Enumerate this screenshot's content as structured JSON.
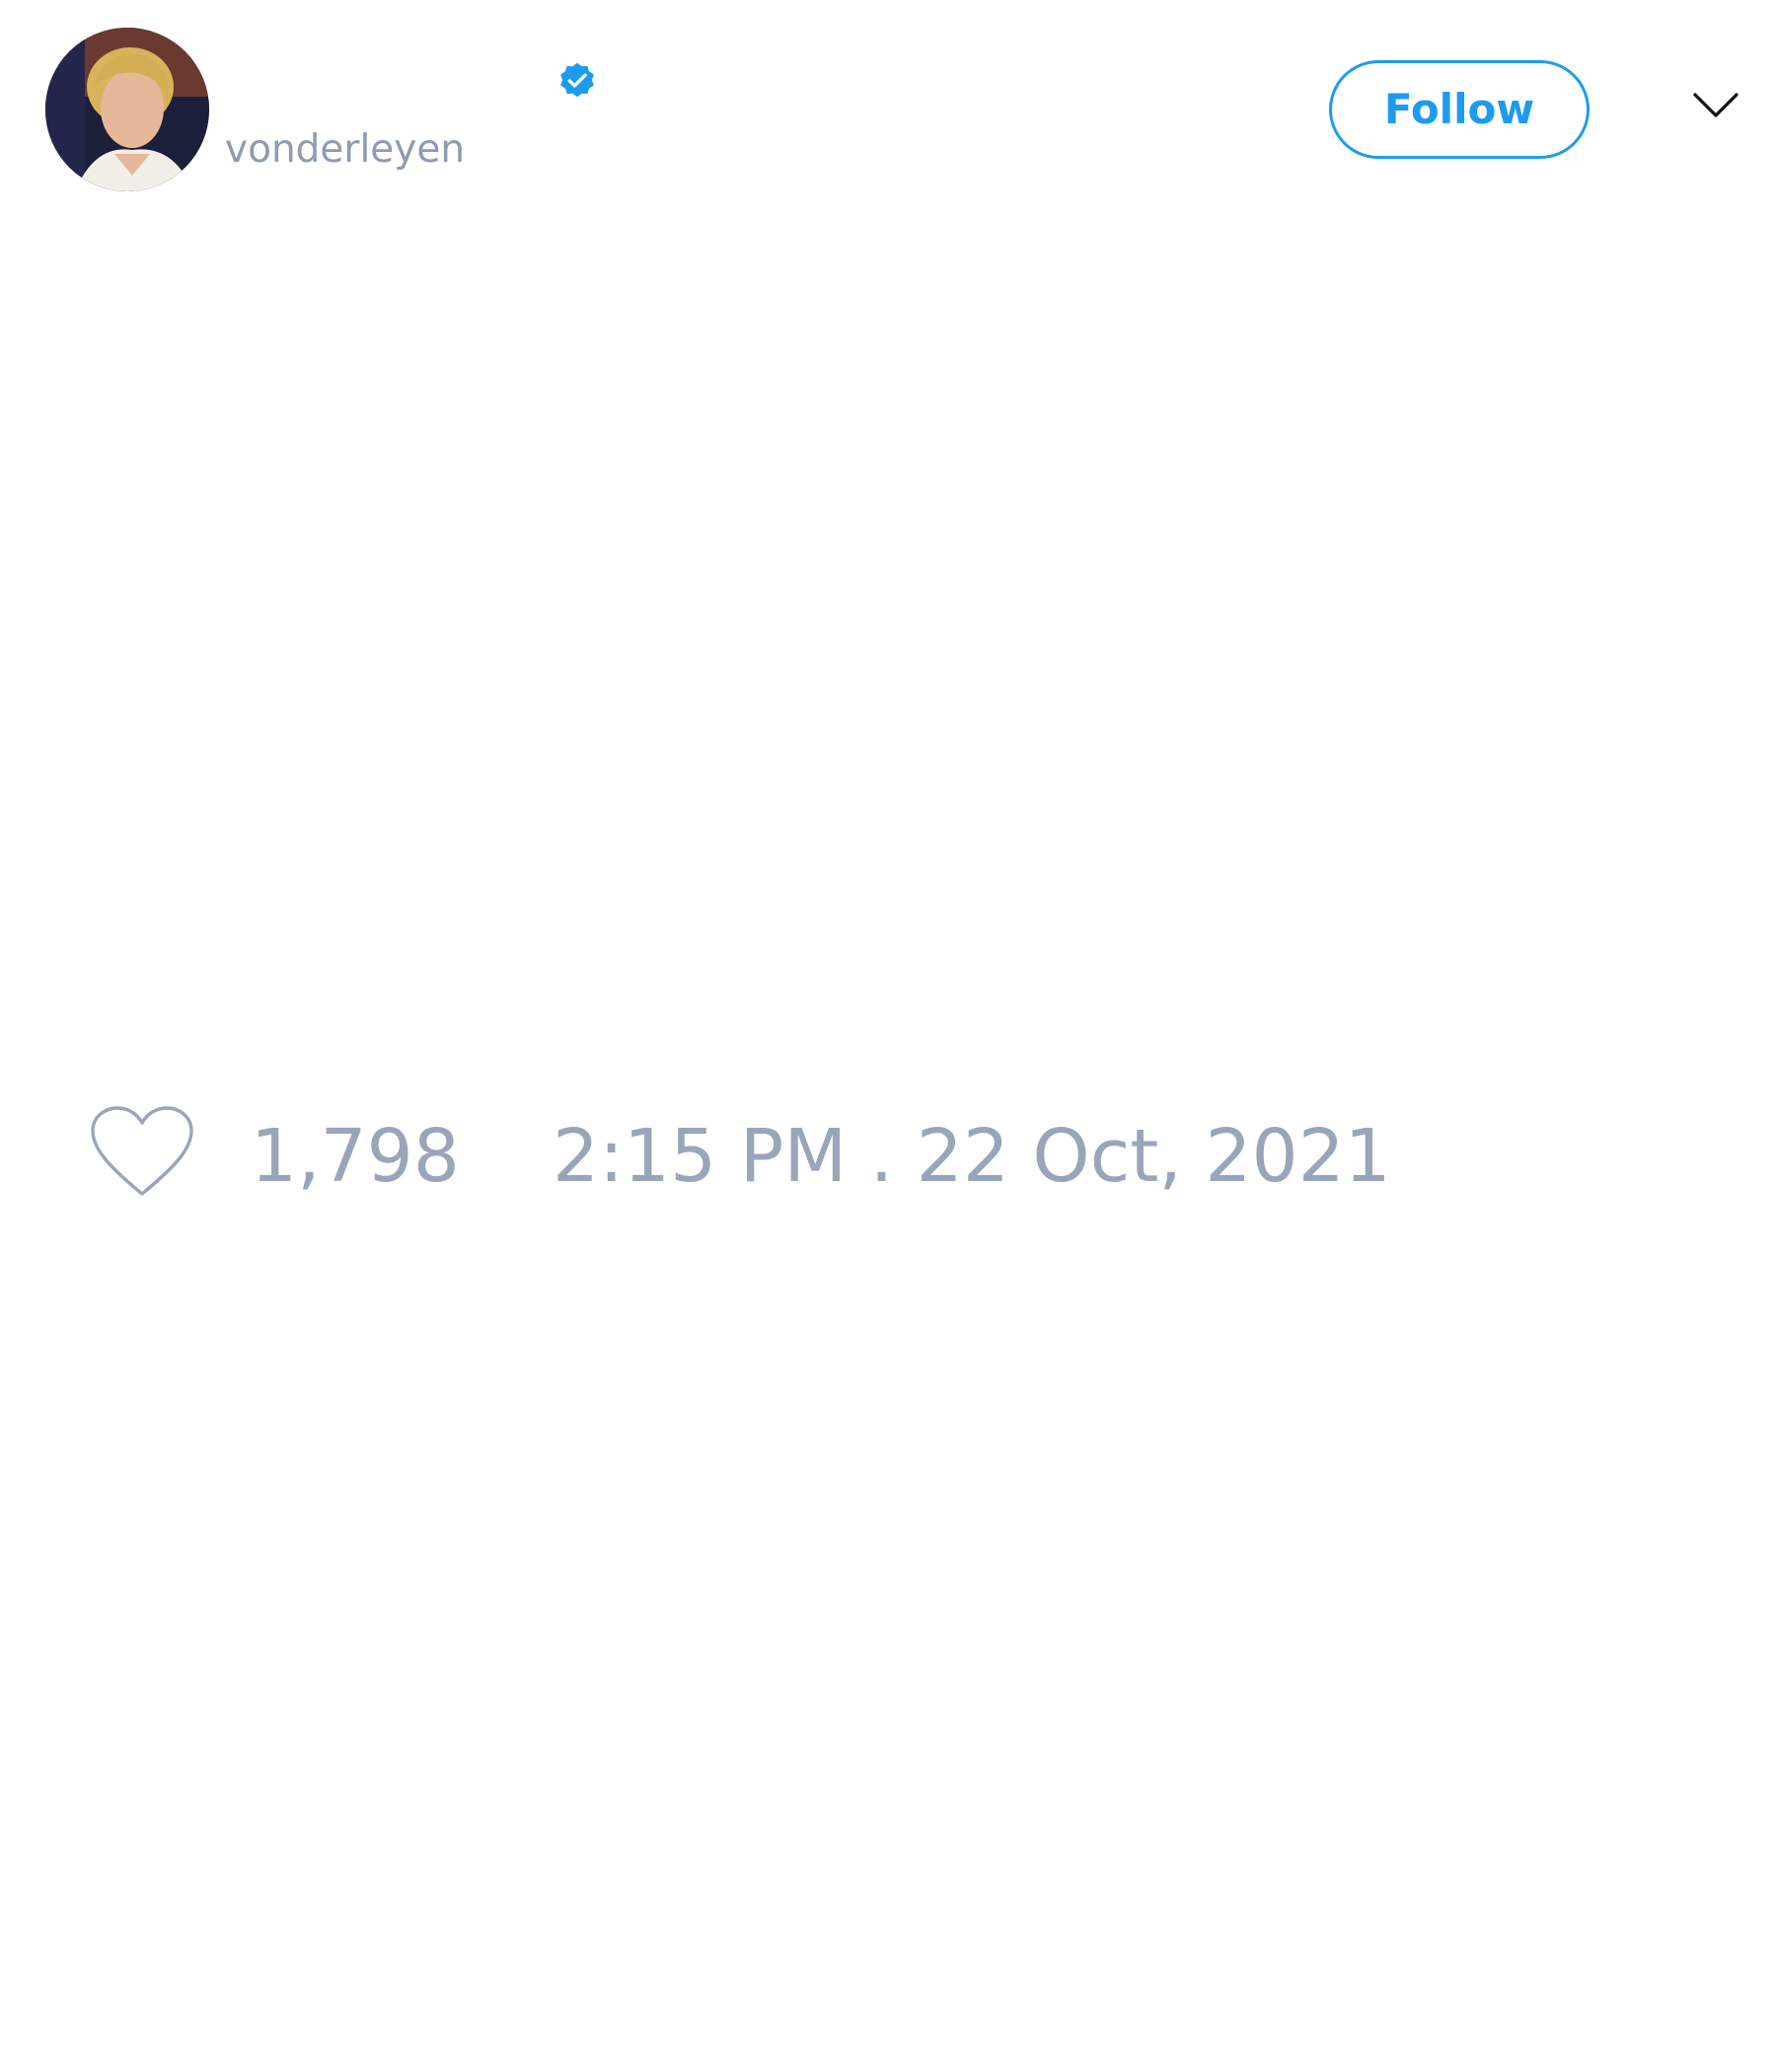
{
  "tweet": {
    "author": {
      "handle": "vonderleyen",
      "verified": true,
      "avatar": "profile-photo"
    },
    "follow_label": "Follow",
    "likes": "1,798",
    "timestamp": "2:15 PM . 22 Oct, 2021"
  },
  "icons": {
    "verified": "verified-badge-icon",
    "menu": "chevron-down-icon",
    "like": "heart-icon"
  },
  "colors": {
    "accent": "#1d9bf0",
    "muted_text": "#99a5b9",
    "background": "#ffffff"
  }
}
